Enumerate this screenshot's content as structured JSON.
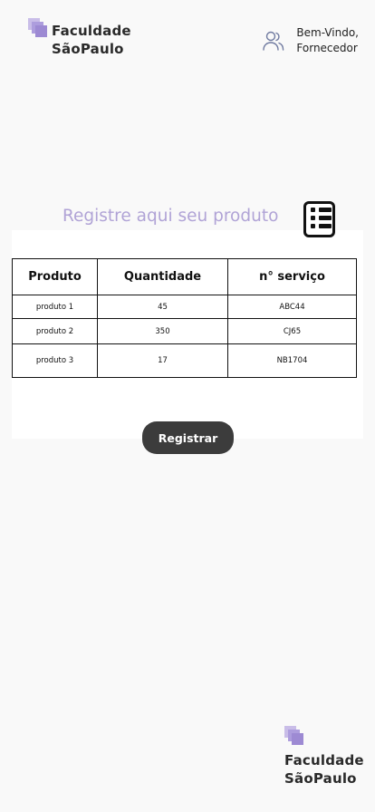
{
  "brand": {
    "line1": "Faculdade",
    "line2": "SãoPaulo"
  },
  "user": {
    "greeting": "Bem-Vindo,",
    "role": "Fornecedor",
    "icon": "users-icon"
  },
  "main": {
    "heading": "Registre aqui seu produto",
    "list_icon": "list-icon",
    "heading_color": "#b0a3d6"
  },
  "table": {
    "headers": [
      "Produto",
      "Quantidade",
      "n° serviço"
    ],
    "rows": [
      [
        "produto 1",
        "45",
        "ABC44"
      ],
      [
        "produto 2",
        "350",
        "CJ65"
      ],
      [
        "produto 3",
        "17",
        "NB1704"
      ]
    ]
  },
  "actions": {
    "register_label": "Registrar",
    "button_color": "#3c3c3c"
  },
  "footer": {
    "line1": "Faculdade",
    "line2": "SãoPaulo"
  }
}
